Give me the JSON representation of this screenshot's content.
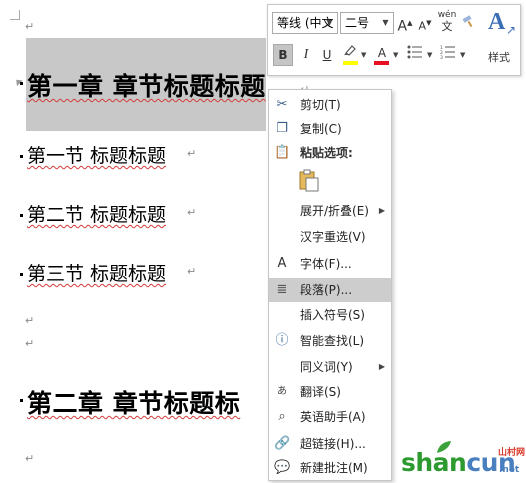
{
  "document": {
    "heading1_a": "第一章  章节标题标题",
    "heading2_a": "第一节  标题标题",
    "heading2_b": "第二节  标题标题",
    "heading2_c": "第三节  标题标题",
    "heading1_b": "第二章  章节标题标",
    "para_mark": "↵"
  },
  "mini_toolbar": {
    "font_name": "等线 (中文",
    "font_size": "二号",
    "grow_font": "A",
    "shrink_font": "A",
    "phonetic": "wén",
    "phonetic_sub": "文",
    "bold": "B",
    "italic": "I",
    "underline": "U",
    "font_color_letter": "A",
    "styles_label": "样式",
    "highlight_color": "#ffff00",
    "font_color": "#e81123"
  },
  "context_menu": {
    "items": [
      {
        "label": "剪切(T)",
        "icon": "scissors-icon"
      },
      {
        "label": "复制(C)",
        "icon": "copy-icon"
      },
      {
        "label": "粘贴选项:",
        "icon": "paste-icon"
      },
      {
        "label": "展开/折叠(E)",
        "icon": ""
      },
      {
        "label": "汉字重选(V)",
        "icon": ""
      },
      {
        "label": "字体(F)...",
        "icon": "font-icon"
      },
      {
        "label": "段落(P)...",
        "icon": "paragraph-icon"
      },
      {
        "label": "插入符号(S)",
        "icon": ""
      },
      {
        "label": "智能查找(L)",
        "icon": "smart-lookup-icon"
      },
      {
        "label": "同义词(Y)",
        "icon": ""
      },
      {
        "label": "翻译(S)",
        "icon": "translate-icon"
      },
      {
        "label": "英语助手(A)",
        "icon": "english-assistant-icon"
      },
      {
        "label": "超链接(H)...",
        "icon": "hyperlink-icon"
      },
      {
        "label": "新建批注(M)",
        "icon": "new-comment-icon"
      }
    ]
  },
  "watermark": {
    "shan": "shan",
    "cun": "cun",
    "net": ".net",
    "cn": "山村网"
  }
}
